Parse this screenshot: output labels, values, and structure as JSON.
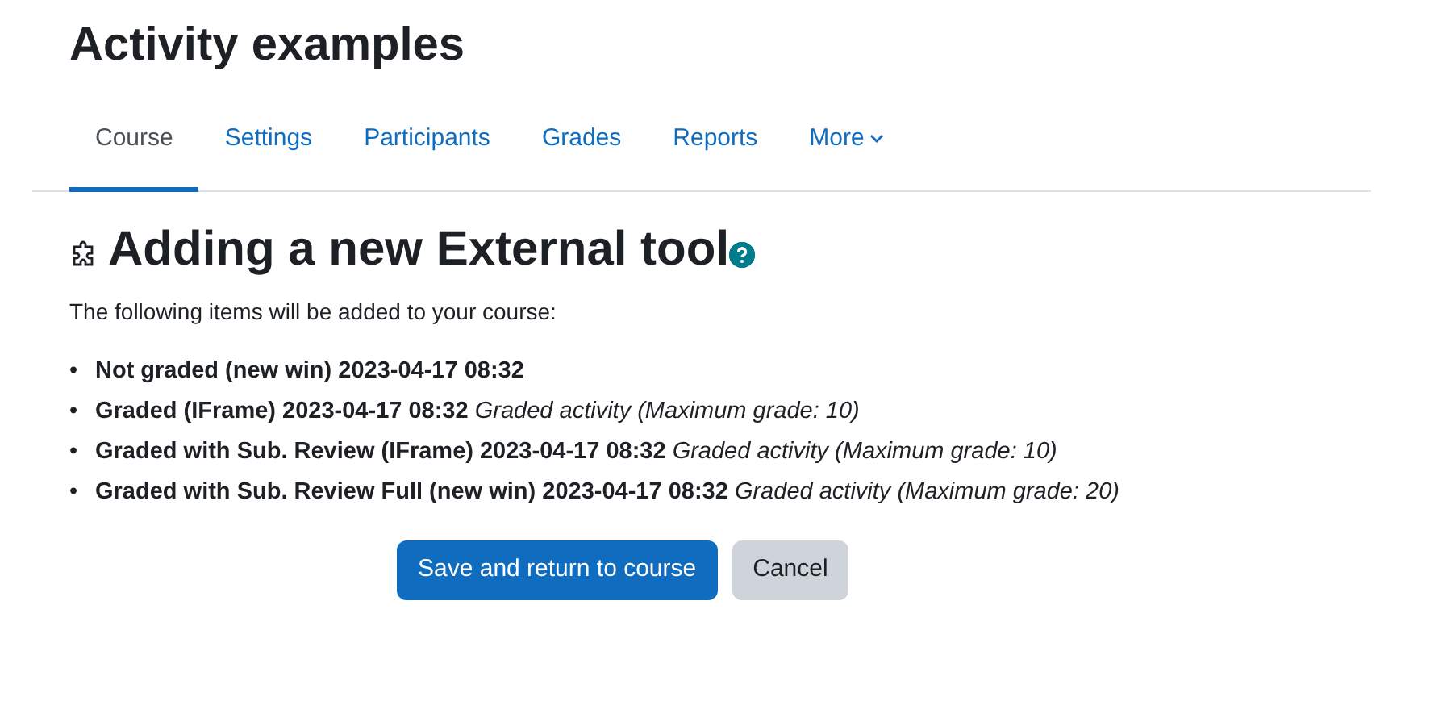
{
  "page_title": "Activity examples",
  "tabs": [
    {
      "label": "Course",
      "selected": true
    },
    {
      "label": "Settings",
      "selected": false
    },
    {
      "label": "Participants",
      "selected": false
    },
    {
      "label": "Grades",
      "selected": false
    },
    {
      "label": "Reports",
      "selected": false
    },
    {
      "label": "More",
      "selected": false,
      "has_menu": true
    }
  ],
  "heading": "Adding a new External tool",
  "intro": "The following items will be added to your course:",
  "items": [
    {
      "marker": "•",
      "title": "Not graded (new win) 2023-04-17 08:32"
    },
    {
      "marker": "•",
      "title": "Graded (IFrame) 2023-04-17 08:32",
      "detail": "Graded activity (Maximum grade: 10)"
    },
    {
      "marker": "•",
      "title": "Graded with Sub. Review (IFrame) 2023-04-17 08:32",
      "detail": "Graded activity (Maximum grade: 10)"
    },
    {
      "marker": "•",
      "title": "Graded with Sub. Review Full (new win) 2023-04-17 08:32",
      "detail": "Graded activity (Maximum grade: 20)"
    }
  ],
  "buttons": [
    {
      "label": "Save and return to course",
      "kind": "primary"
    },
    {
      "label": "Cancel",
      "kind": "secondary"
    }
  ]
}
